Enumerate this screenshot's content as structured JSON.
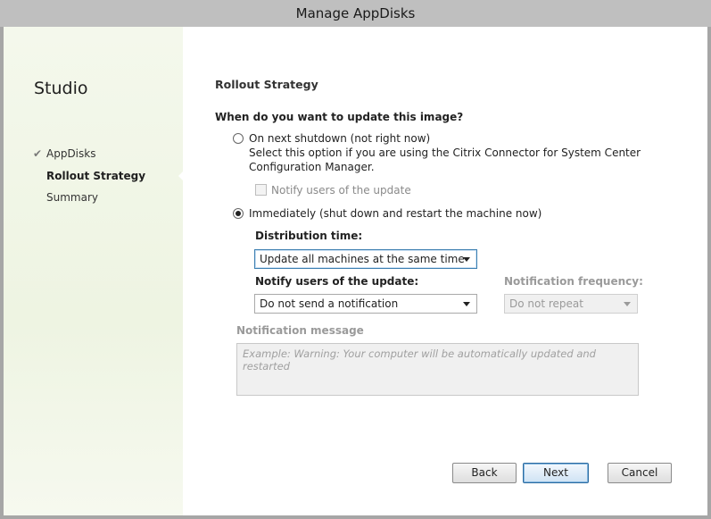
{
  "window": {
    "title": "Manage AppDisks"
  },
  "sidebar": {
    "title": "Studio",
    "steps": [
      {
        "label": "AppDisks",
        "state": "completed"
      },
      {
        "label": "Rollout Strategy",
        "state": "active"
      },
      {
        "label": "Summary",
        "state": "pending"
      }
    ],
    "check_icon": "checkmark-icon"
  },
  "main": {
    "section_title": "Rollout Strategy",
    "question": "When do you want to update this image?",
    "option_shutdown": {
      "label": "On next shutdown (not right now)",
      "description_line1": "Select this option if you are using the Citrix Connector for System Center",
      "description_line2": "Configuration Manager.",
      "selected": false,
      "notify_checkbox_label": "Notify users of the update",
      "notify_checked": false
    },
    "option_immediately": {
      "label": "Immediately (shut down and restart the machine now)",
      "selected": true
    },
    "distribution_time": {
      "label": "Distribution time:",
      "value": "Update all machines at the same time"
    },
    "notify_users": {
      "label": "Notify users of the update:",
      "value": "Do not send a notification"
    },
    "notification_frequency": {
      "label": "Notification frequency:",
      "value": "Do not repeat",
      "disabled": true
    },
    "notification_message": {
      "label": "Notification message",
      "placeholder": "Example:  Warning: Your computer will be automatically updated and restarted",
      "disabled": true
    }
  },
  "footer": {
    "back_label": "Back",
    "next_label": "Next",
    "cancel_label": "Cancel"
  },
  "colors": {
    "accent": "#3c7fb1",
    "sidebar_bg": "#eef4e2"
  }
}
